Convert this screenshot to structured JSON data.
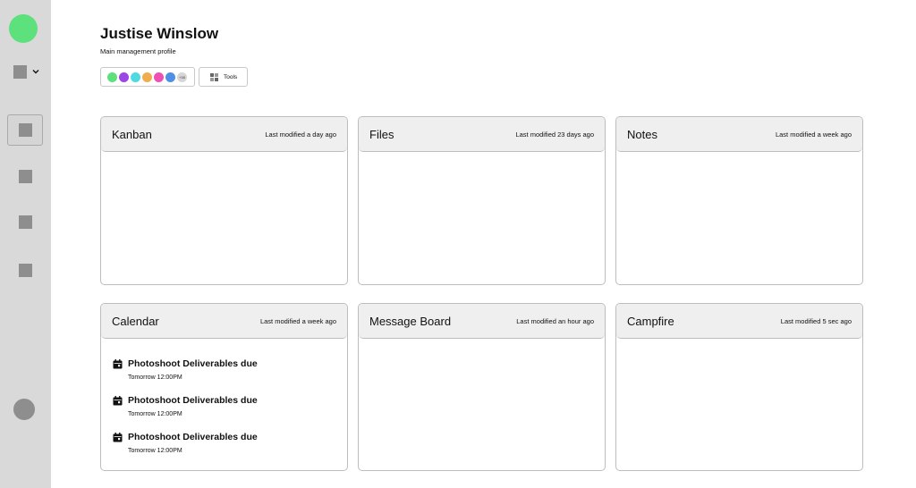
{
  "profile": {
    "name": "Justise Winslow",
    "subtitle": "Main management profile",
    "members_more": "+38",
    "member_colors": [
      "#5ce17c",
      "#9b46e6",
      "#4fd9e0",
      "#f0ad4e",
      "#ee4fb3",
      "#4f8fe6"
    ],
    "tools_label": "Tools"
  },
  "cards": [
    {
      "title": "Kanban",
      "modified": "Last modified a day ago"
    },
    {
      "title": "Files",
      "modified": "Last modified 23 days ago"
    },
    {
      "title": "Notes",
      "modified": "Last modified a week ago"
    },
    {
      "title": "Calendar",
      "modified": "Last modified a week ago"
    },
    {
      "title": "Message Board",
      "modified": "Last modified an hour ago"
    },
    {
      "title": "Campfire",
      "modified": "Last modified 5 sec ago"
    }
  ],
  "calendar_events": [
    {
      "name": "Photoshoot Deliverables due",
      "time": "Tomorrow 12:00PM"
    },
    {
      "name": "Photoshoot Deliverables due",
      "time": "Tomorrow 12:00PM"
    },
    {
      "name": "Photoshoot Deliverables due",
      "time": "Tomorrow 12:00PM"
    }
  ],
  "colors": {
    "sidebar_bg": "#d9d9d9",
    "accent_green": "#5ce17c",
    "card_header_bg": "#efefef"
  }
}
